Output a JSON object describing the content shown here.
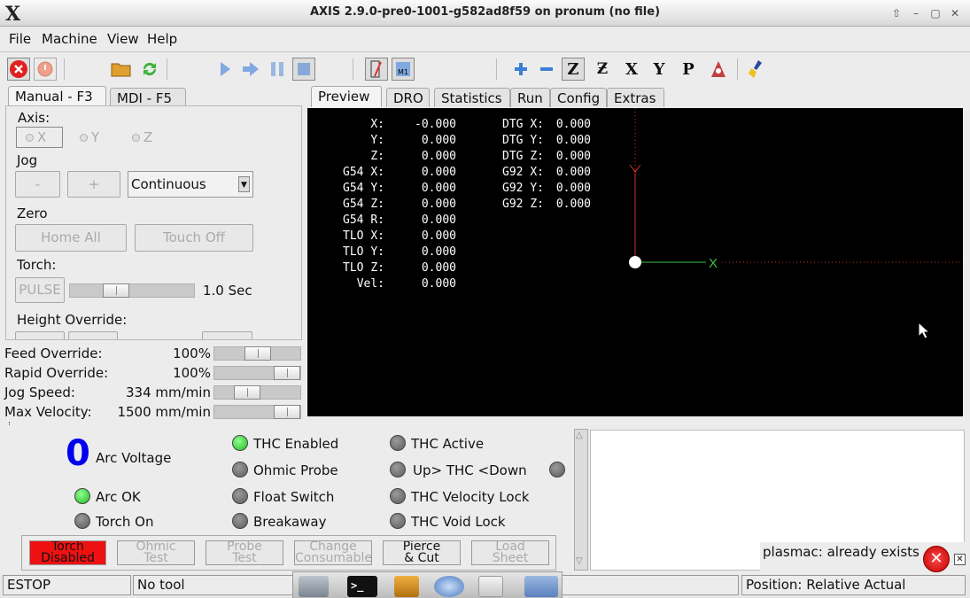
{
  "window": {
    "title": "AXIS 2.9.0-pre0-1001-g582ad8f59 on pronum (no file)",
    "logo": "X"
  },
  "menu": [
    "File",
    "Machine",
    "View",
    "Help"
  ],
  "left_tabs": [
    "Manual - F3",
    "MDI - F5"
  ],
  "right_tabs": [
    "Preview",
    "DRO",
    "Statistics",
    "Run",
    "Config",
    "Extras"
  ],
  "manual": {
    "axis_label": "Axis:",
    "axes": [
      "X",
      "Y",
      "Z"
    ],
    "jog_label": "Jog",
    "jog_minus": "-",
    "jog_plus": "+",
    "jog_mode": "Continuous",
    "zero_label": "Zero",
    "home_all": "Home All",
    "touch_off": "Touch Off",
    "torch_label": "Torch:",
    "pulse": "PULSE",
    "pulse_time": "1.0 Sec",
    "height_override_label": "Height Override:"
  },
  "overrides": [
    {
      "label": "Feed Override:",
      "value": "100",
      "unit": "%",
      "level": 0.5
    },
    {
      "label": "Rapid Override:",
      "value": "100",
      "unit": "%",
      "level": 1.0
    },
    {
      "label": "Jog Speed:",
      "value": "334",
      "unit": "mm/min",
      "level": 0.33
    },
    {
      "label": "Max Velocity:",
      "value": "1500",
      "unit": "mm/min",
      "level": 1.0
    }
  ],
  "dro": {
    "left_labels": [
      "X:",
      "Y:",
      "Z:",
      "G54 X:",
      "G54 Y:",
      "G54 Z:",
      "G54 R:",
      "TLO X:",
      "TLO Y:",
      "TLO Z:",
      "Vel:"
    ],
    "left_values": [
      "-0.000",
      "0.000",
      "0.000",
      "0.000",
      "0.000",
      "0.000",
      "0.000",
      "0.000",
      "0.000",
      "0.000",
      "0.000"
    ],
    "right_labels": [
      "DTG X:",
      "DTG Y:",
      "DTG Z:",
      "G92 X:",
      "G92 Y:",
      "G92 Z:"
    ],
    "right_values": [
      "0.000",
      "0.000",
      "0.000",
      "0.000",
      "0.000",
      "0.000"
    ],
    "axis_x_label": "X"
  },
  "plasma": {
    "arc_voltage_value": "0",
    "arc_voltage_label": "Arc Voltage",
    "arc_ok": "Arc OK",
    "torch_on": "Torch On",
    "thc_enabled": "THC Enabled",
    "ohmic_probe": "Ohmic Probe",
    "float_switch": "Float Switch",
    "breakaway": "Breakaway",
    "thc_active": "THC Active",
    "up_thc_down": "Up> THC <Down",
    "thc_velocity_lock": "THC Velocity Lock",
    "thc_void_lock": "THC Void Lock",
    "buttons": [
      {
        "l1": "Torch",
        "l2": "Disabled"
      },
      {
        "l1": "Ohmic",
        "l2": "Test"
      },
      {
        "l1": "Probe",
        "l2": "Test"
      },
      {
        "l1": "Change",
        "l2": "Consumable"
      },
      {
        "l1": "Pierce",
        "l2": "& Cut"
      },
      {
        "l1": "Load",
        "l2": "Sheet"
      }
    ]
  },
  "notification": {
    "text": "plasmac: already exists"
  },
  "status": {
    "estop": "ESTOP",
    "tool": "No tool",
    "position": "Position: Relative Actual"
  },
  "colors": {
    "accent_blue": "#0000ee",
    "led_green": "#22bb22",
    "torch_red": "#ee1111"
  },
  "icons": [
    "estop-icon",
    "power-icon",
    "open-folder-icon",
    "reload-icon",
    "run-icon",
    "step-icon",
    "pause-icon",
    "stop-icon",
    "block-delete-icon",
    "optional-stop-icon",
    "zoom-in-icon",
    "zoom-out-icon",
    "view-z-icon",
    "view-z2-icon",
    "view-x-icon",
    "view-y-icon",
    "view-p-icon",
    "rotate-icon",
    "clear-plot-icon"
  ]
}
